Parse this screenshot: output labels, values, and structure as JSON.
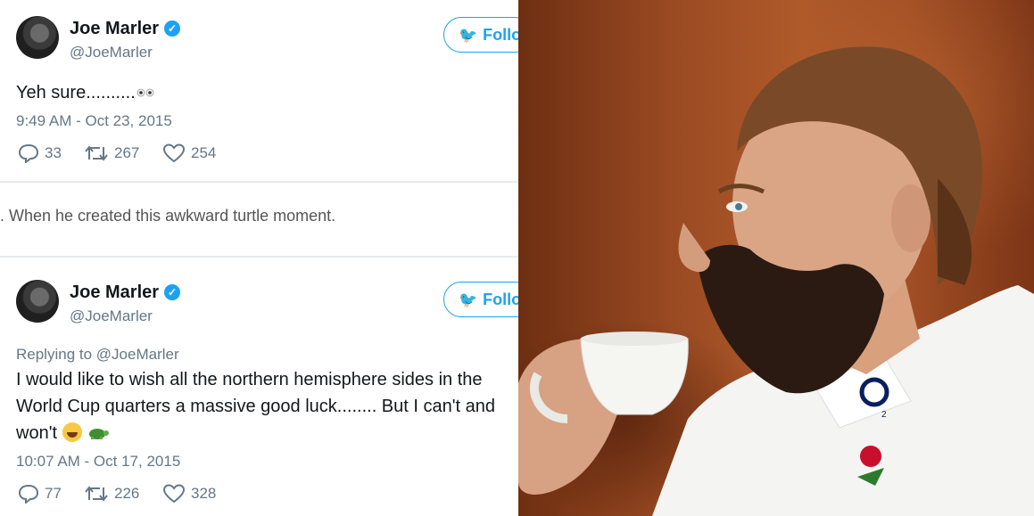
{
  "tweets": [
    {
      "name": "Joe Marler",
      "handle": "@JoeMarler",
      "follow_label": "Follow",
      "text": "Yeh sure..........",
      "time": "9:49 AM - Oct 23, 2015",
      "replies": "33",
      "retweets": "267",
      "likes": "254"
    },
    {
      "name": "Joe Marler",
      "handle": "@JoeMarler",
      "follow_label": "Follow",
      "replying_to": "Replying to @JoeMarler",
      "text_line1": "I would like to wish all the northern hemisphere sides in the",
      "text_line2": "World Cup quarters a massive good luck........ But I can't and",
      "text_line3": "won't",
      "time": "10:07 AM - Oct 17, 2015",
      "replies": "77",
      "retweets": "226",
      "likes": "328"
    }
  ],
  "caption": ". When he created this awkward turtle moment.",
  "icons": {
    "verified": "verified-badge-icon",
    "bird": "twitter-bird-icon",
    "reply": "reply-icon",
    "retweet": "retweet-icon",
    "like": "heart-icon"
  },
  "colors": {
    "accent": "#1da1f2",
    "muted": "#657786",
    "background_photo": "#9a4a22",
    "shirt": "#f4f4f2"
  }
}
